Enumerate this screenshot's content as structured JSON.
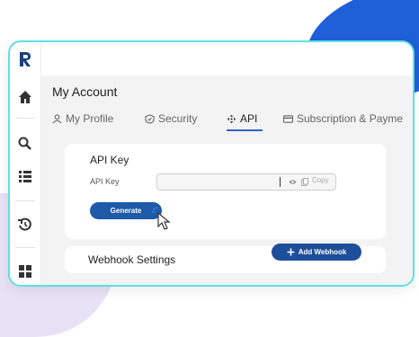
{
  "page": {
    "title": "My Account"
  },
  "tabs": [
    {
      "label": "My Profile",
      "icon": "user-icon"
    },
    {
      "label": "Security",
      "icon": "shield-icon"
    },
    {
      "label": "API",
      "icon": "api-move-icon"
    },
    {
      "label": "Subscription & Payme",
      "icon": "card-icon"
    }
  ],
  "sidebar": {
    "logo": "R",
    "items": [
      {
        "icon": "home-icon"
      },
      {
        "icon": "search-icon"
      },
      {
        "icon": "list-icon"
      },
      {
        "icon": "history-icon"
      },
      {
        "icon": "grid-icon"
      }
    ]
  },
  "api_key": {
    "title": "API Key",
    "field_label": "API Key",
    "value": "",
    "copy_label": "Copy",
    "generate_label": "Generate"
  },
  "webhook": {
    "title": "Webhook Settings",
    "add_label": "Add Webhook"
  },
  "colors": {
    "accent": "#2d64c8",
    "button": "#1e5aa8",
    "border": "#5ee0e6"
  }
}
